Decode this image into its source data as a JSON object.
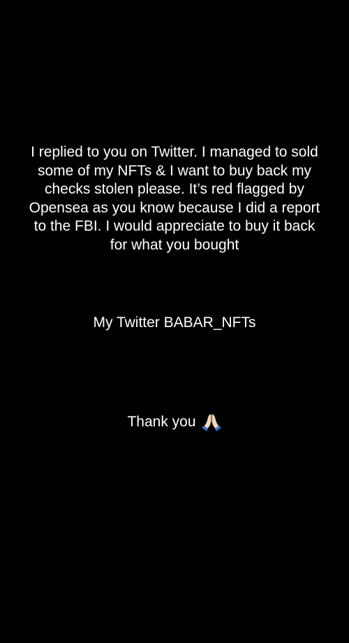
{
  "message": {
    "paragraph_lines": [
      "I replied to you on Twitter. I managed to sold",
      "some of my NFTs & I want to buy back my",
      "checks stolen please. It’s red flagged by",
      "Opensea as you know because I did a report",
      "to the FBI. I would appreciate to buy it back",
      "for what you bought"
    ],
    "twitter_line": "My Twitter BABAR_NFTs",
    "thanks_text": "Thank you",
    "thanks_icon": "folded-hands-icon"
  },
  "colors": {
    "background": "#000000",
    "text": "#ffffff"
  }
}
